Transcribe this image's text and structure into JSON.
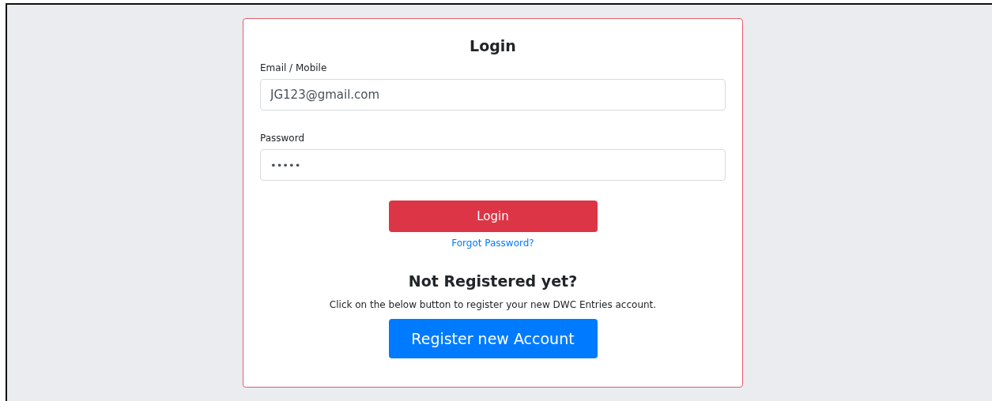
{
  "title": "Login",
  "fields": [
    {
      "label": "Email / Mobile",
      "value": "JG123@gmail.com",
      "kind": "text"
    },
    {
      "label": "Password",
      "value": "•••••",
      "kind": "password"
    }
  ],
  "login_button": "Login",
  "forgot_link": "Forgot Password?",
  "register": {
    "heading": "Not Registered yet?",
    "text": "Click on the below button to register your new DWC Entries account.",
    "button": "Register new Account"
  }
}
